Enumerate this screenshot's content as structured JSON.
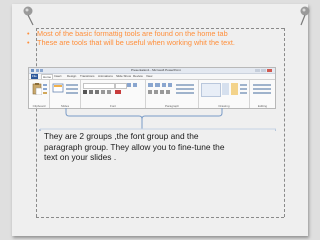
{
  "bullets": [
    "Most of the basic formattig tools are found on the home tab",
    "These are tools that will be useful when working whit the text."
  ],
  "bullet_symbol": "•",
  "ribbon": {
    "window_title": "Presentation1 - Microsoft PowerPoint",
    "tabs": [
      "File",
      "Home",
      "Insert",
      "Design",
      "Transitions",
      "Animations",
      "Slide Show",
      "Review",
      "View"
    ],
    "groups": [
      "Clipboard",
      "Slides",
      "Font",
      "Paragraph",
      "Drawing",
      "Editing"
    ]
  },
  "callout_lines": [
    "They are 2 groups ,the font group and the",
    "paragraph group. They allow you to fine-tune the",
    "text on your slides ."
  ],
  "colors": {
    "bullet_text": "#ff8f3b",
    "background": "#efefef",
    "callout_text": "#1a1a1a"
  }
}
